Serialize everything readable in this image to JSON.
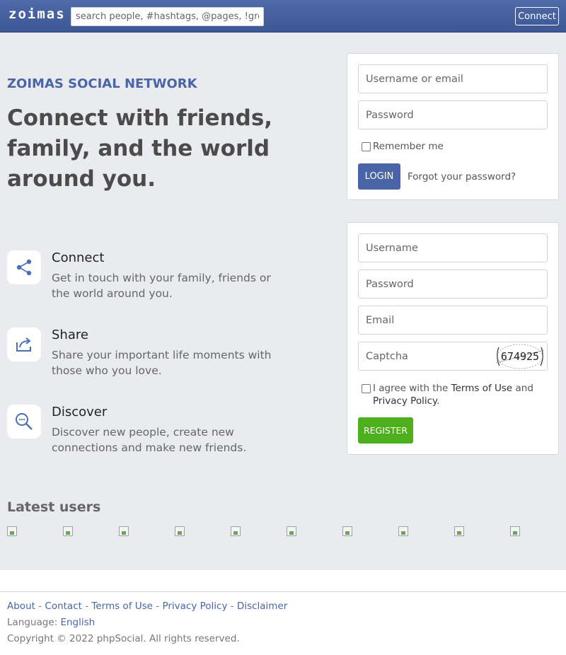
{
  "header": {
    "logo": "zoimas",
    "search_placeholder": "search people, #hashtags, @pages, !groups",
    "connect_label": "Connect"
  },
  "hero": {
    "brand": "ZOIMAS SOCIAL NETWORK",
    "tagline": "Connect with friends, family, and the world around you."
  },
  "features": [
    {
      "icon": "share-nodes-icon",
      "title": "Connect",
      "description": "Get in touch with your family, friends or the world around you."
    },
    {
      "icon": "share-arrow-icon",
      "title": "Share",
      "description": "Share your important life moments with those who you love."
    },
    {
      "icon": "search-discover-icon",
      "title": "Discover",
      "description": "Discover new people, create new connections and make new friends."
    }
  ],
  "latest_users": {
    "title": "Latest users",
    "count": 10
  },
  "login": {
    "username_placeholder": "Username or email",
    "password_placeholder": "Password",
    "remember_label": "Remember me",
    "login_label": "LOGIN",
    "forgot_label": "Forgot your password?"
  },
  "register": {
    "username_placeholder": "Username",
    "password_placeholder": "Password",
    "email_placeholder": "Email",
    "captcha_placeholder": "Captcha",
    "captcha_text": "674925",
    "agree_prefix": "I agree with the",
    "terms_link": "Terms of Use",
    "agree_and": "and",
    "privacy_link": "Privacy Policy",
    "agree_suffix": ".",
    "register_label": "REGISTER"
  },
  "footer": {
    "links": [
      "About",
      "Contact",
      "Terms of Use",
      "Privacy Policy",
      "Disclaimer"
    ],
    "separator": " - ",
    "language_label": "Language:",
    "language_value": "English",
    "copyright": "Copyright © 2022 phpSocial. All rights reserved."
  },
  "colors": {
    "brand_blue": "#4a64a8",
    "register_green": "#4caf1b",
    "background": "#e9ebee"
  }
}
